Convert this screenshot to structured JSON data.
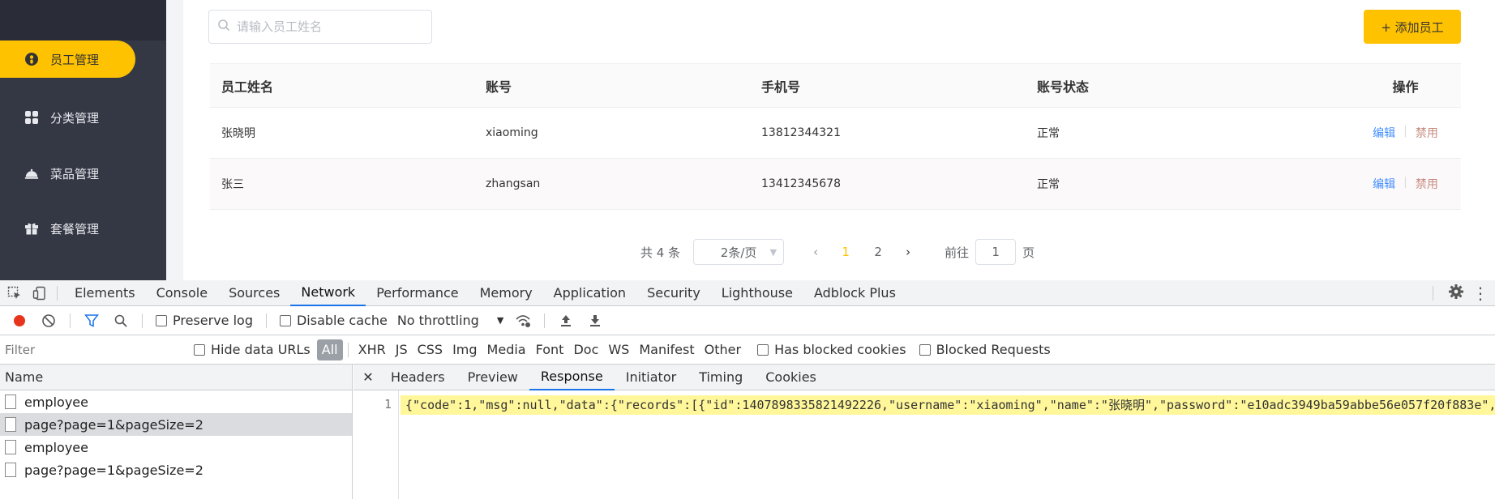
{
  "sidebar": {
    "items": [
      {
        "label": "员工管理",
        "icon": "employee-icon",
        "active": true
      },
      {
        "label": "分类管理",
        "icon": "grid-icon",
        "active": false
      },
      {
        "label": "菜品管理",
        "icon": "dish-cover-icon",
        "active": false
      },
      {
        "label": "套餐管理",
        "icon": "gift-icon",
        "active": false
      }
    ]
  },
  "toolbar": {
    "search_placeholder": "请输入员工姓名",
    "add_button": "+ 添加员工"
  },
  "table": {
    "headers": [
      "员工姓名",
      "账号",
      "手机号",
      "账号状态",
      "操作"
    ],
    "rows": [
      {
        "name": "张晓明",
        "account": "xiaoming",
        "phone": "13812344321",
        "status": "正常",
        "edit": "编辑",
        "disable": "禁用"
      },
      {
        "name": "张三",
        "account": "zhangsan",
        "phone": "13412345678",
        "status": "正常",
        "edit": "编辑",
        "disable": "禁用"
      }
    ]
  },
  "pagination": {
    "total": "共 4 条",
    "page_size": "2条/页",
    "prev": "‹",
    "pages": [
      "1",
      "2"
    ],
    "current_page": "1",
    "next": "›",
    "goto_label": "前往",
    "goto_value": "1",
    "goto_suffix": "页"
  },
  "devtools": {
    "tabs": [
      "Elements",
      "Console",
      "Sources",
      "Network",
      "Performance",
      "Memory",
      "Application",
      "Security",
      "Lighthouse",
      "Adblock Plus"
    ],
    "active_tab": "Network",
    "toolbar": {
      "preserve_log": "Preserve log",
      "disable_cache": "Disable cache",
      "throttling": "No throttling"
    },
    "filter": {
      "placeholder": "Filter",
      "hide_data_urls": "Hide data URLs",
      "types": [
        "All",
        "XHR",
        "JS",
        "CSS",
        "Img",
        "Media",
        "Font",
        "Doc",
        "WS",
        "Manifest",
        "Other"
      ],
      "has_blocked_cookies": "Has blocked cookies",
      "blocked_requests": "Blocked Requests"
    },
    "requests_header": "Name",
    "requests": [
      {
        "name": "employee",
        "selected": false
      },
      {
        "name": "page?page=1&pageSize=2",
        "selected": true
      },
      {
        "name": "employee",
        "selected": false
      },
      {
        "name": "page?page=1&pageSize=2",
        "selected": false
      }
    ],
    "detail_tabs": [
      "Headers",
      "Preview",
      "Response",
      "Initiator",
      "Timing",
      "Cookies"
    ],
    "active_detail_tab": "Response",
    "response_line_number": "1",
    "response_text": "{\"code\":1,\"msg\":null,\"data\":{\"records\":[{\"id\":1407898335821492226,\"username\":\"xiaoming\",\"name\":\"张晓明\",\"password\":\"e10adc3949ba59abbe56e057f20f883e\",\"p"
  },
  "colors": {
    "accent": "#ffc200",
    "sidebar_bg": "#343744",
    "link_edit": "#418dff",
    "link_disable": "#c68a7e",
    "devtools_blue": "#1a73e8",
    "record_red": "#e8341c"
  }
}
